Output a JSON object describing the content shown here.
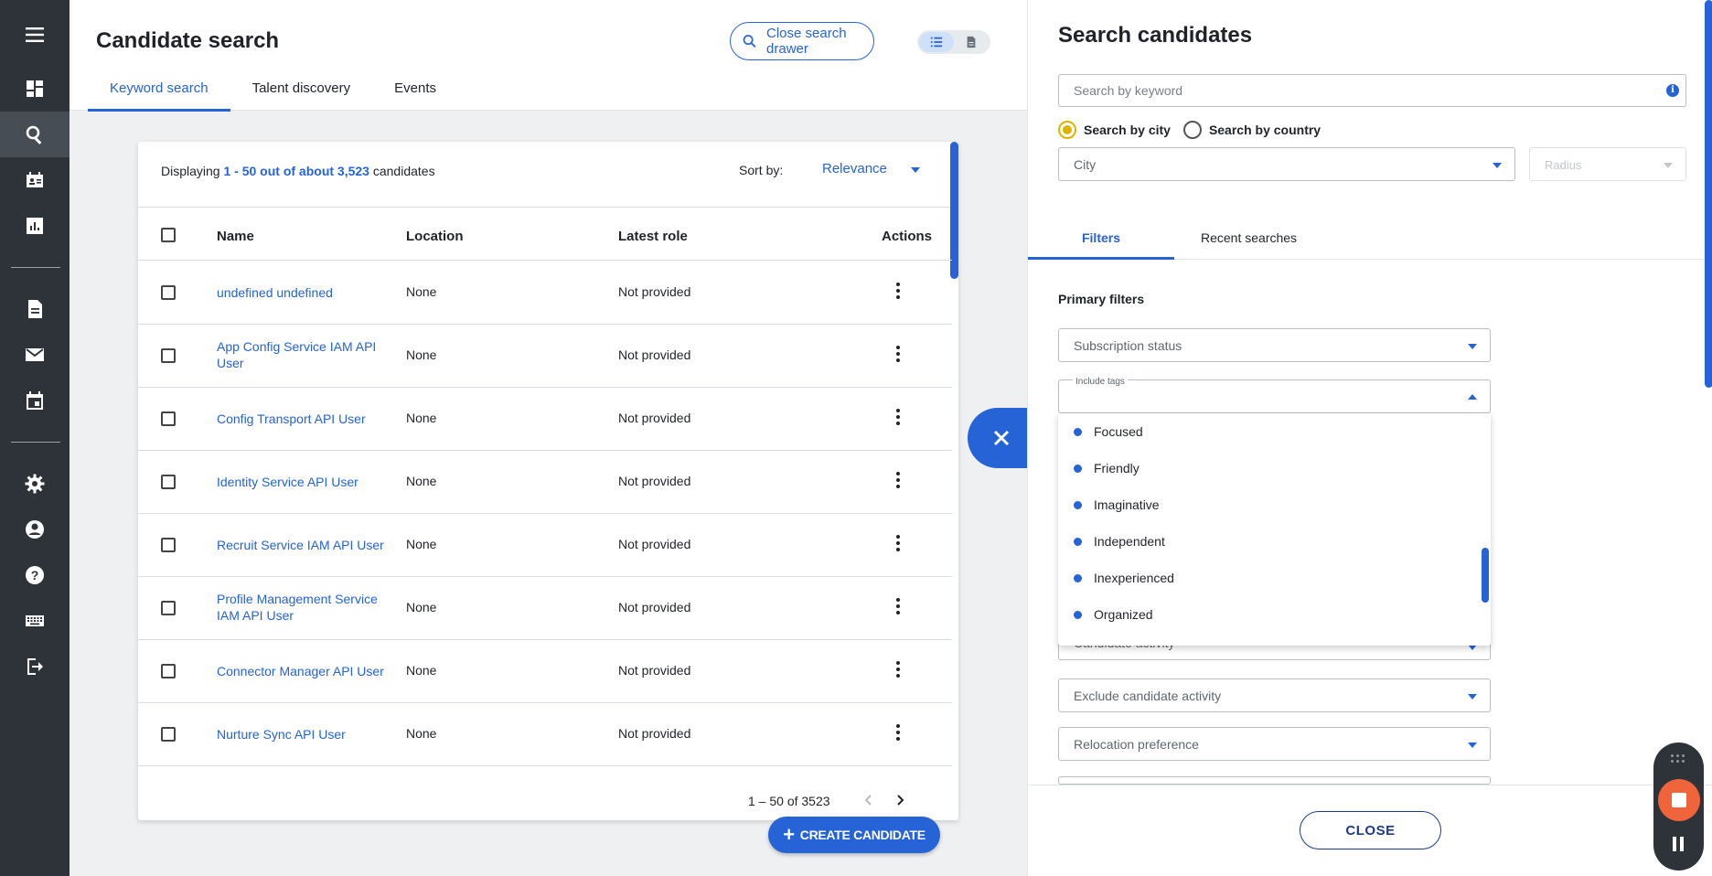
{
  "nav": {
    "items": [
      "menu-icon",
      "dashboard-icon",
      "search-icon",
      "contacts-icon",
      "reports-icon",
      "document-icon",
      "mail-icon",
      "calendar-icon",
      "settings-icon",
      "account-icon",
      "help-icon",
      "keyboard-icon",
      "logout-icon"
    ]
  },
  "header": {
    "title": "Candidate search",
    "close_drawer_label": "Close search drawer",
    "tabs": [
      "Keyword search",
      "Talent discovery",
      "Events"
    ]
  },
  "results": {
    "display_prefix": "Displaying ",
    "display_range": "1 - 50 out of about 3,523",
    "display_suffix": " candidates",
    "sort_label": "Sort by:",
    "sort_value": "Relevance",
    "columns": [
      "Name",
      "Location",
      "Latest role",
      "Actions"
    ],
    "rows": [
      {
        "name": "undefined undefined",
        "location": "None",
        "role": "Not provided"
      },
      {
        "name": "App Config Service IAM API User",
        "location": "None",
        "role": "Not provided"
      },
      {
        "name": "Config Transport API User",
        "location": "None",
        "role": "Not provided"
      },
      {
        "name": "Identity Service API User",
        "location": "None",
        "role": "Not provided"
      },
      {
        "name": "Recruit Service IAM API User",
        "location": "None",
        "role": "Not provided"
      },
      {
        "name": "Profile Management Service IAM API User",
        "location": "None",
        "role": "Not provided"
      },
      {
        "name": "Connector Manager API User",
        "location": "None",
        "role": "Not provided"
      },
      {
        "name": "Nurture Sync API User",
        "location": "None",
        "role": "Not provided"
      }
    ],
    "pager_text": "1 – 50 of 3523",
    "create_label": "CREATE CANDIDATE"
  },
  "drawer": {
    "title": "Search candidates",
    "keyword_placeholder": "Search by keyword",
    "radio_city": "Search by city",
    "radio_country": "Search by country",
    "city_placeholder": "City",
    "radius_placeholder": "Radius",
    "tabs": [
      "Filters",
      "Recent searches"
    ],
    "primary_filters": "Primary filters",
    "subscription_status": "Subscription status",
    "include_tags_label": "Include tags",
    "tag_options": [
      "Focused",
      "Friendly",
      "Imaginative",
      "Independent",
      "Inexperienced",
      "Organized"
    ],
    "hidden_field_fragment": "Candidate activity",
    "exclude_activity": "Exclude candidate activity",
    "relocation": "Relocation preference",
    "close_label": "CLOSE"
  },
  "colors": {
    "accent": "#2563d6",
    "nav_bg": "#2e3339",
    "radio_on": "#e0b300",
    "record": "#f0643c"
  }
}
